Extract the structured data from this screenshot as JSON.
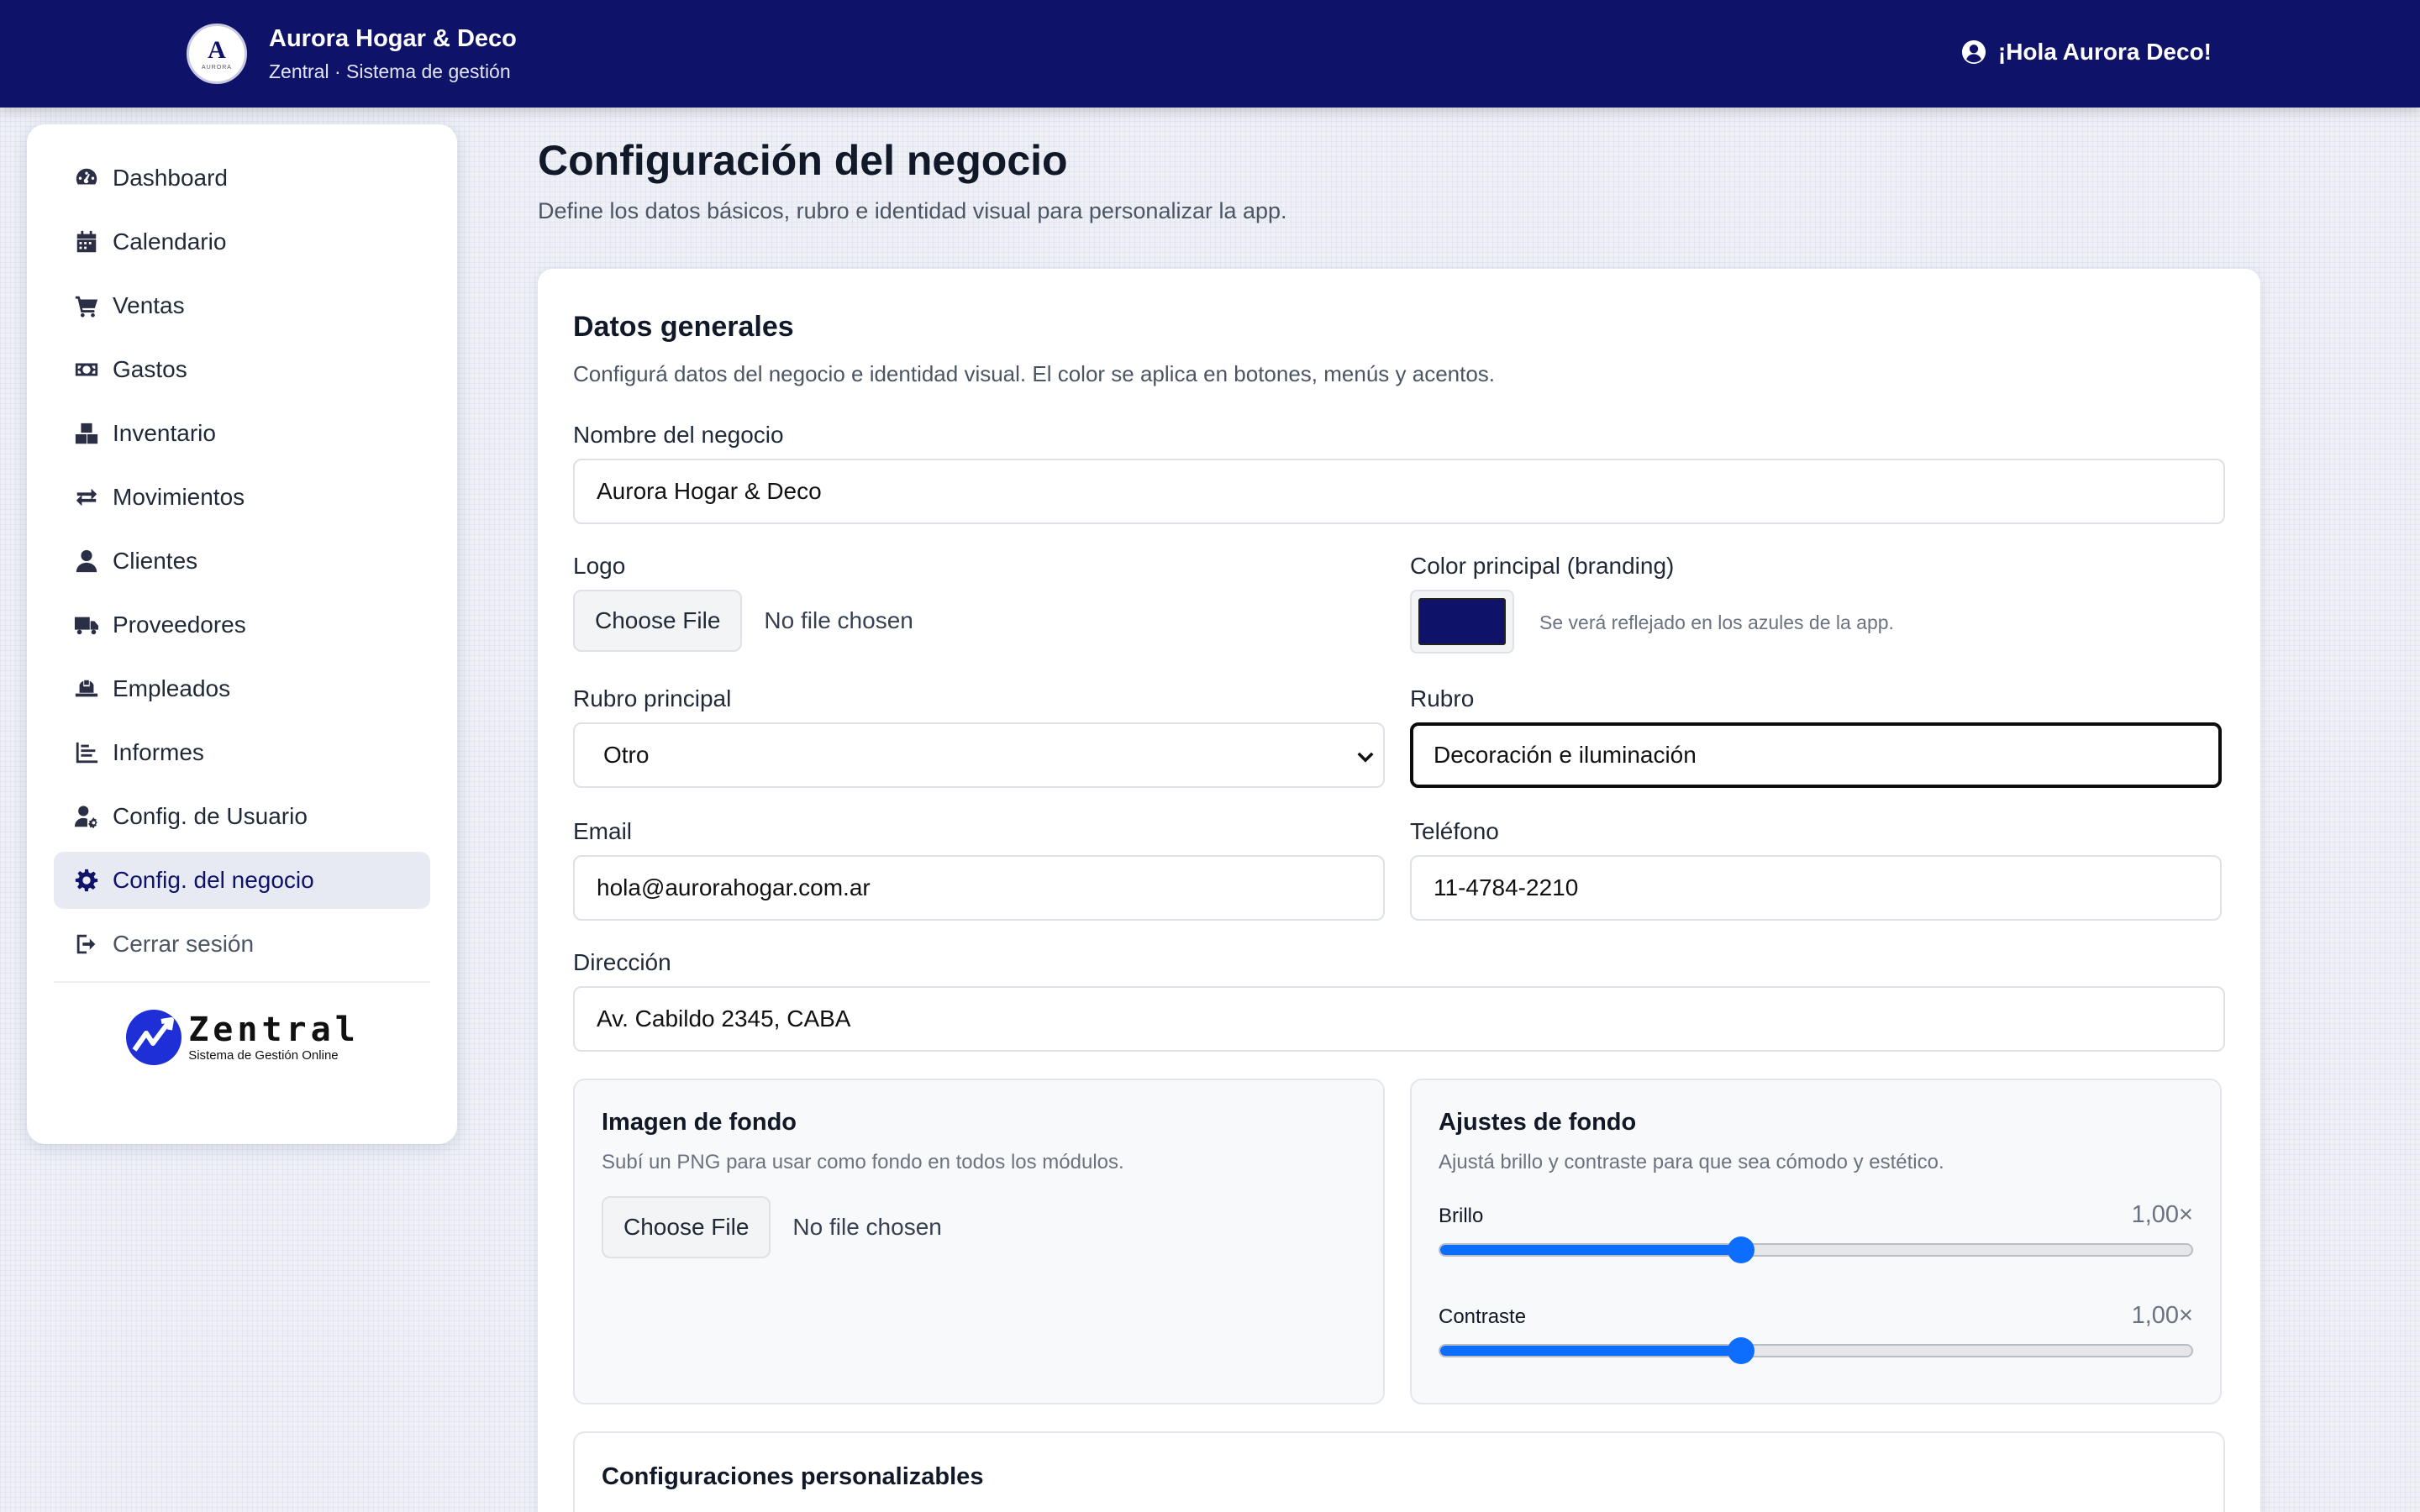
{
  "header": {
    "logo_letter": "A",
    "logo_caption": "AURORA",
    "business_name": "Aurora Hogar & Deco",
    "subtitle": "Zentral · Sistema de gestión",
    "greeting": "¡Hola Aurora Deco!",
    "background_color": "#0e1268"
  },
  "sidebar": {
    "items": [
      {
        "label": "Dashboard",
        "icon": "gauge-icon"
      },
      {
        "label": "Calendario",
        "icon": "calendar-icon"
      },
      {
        "label": "Ventas",
        "icon": "cart-icon"
      },
      {
        "label": "Gastos",
        "icon": "money-icon"
      },
      {
        "label": "Inventario",
        "icon": "boxes-icon"
      },
      {
        "label": "Movimientos",
        "icon": "arrows-icon"
      },
      {
        "label": "Clientes",
        "icon": "user-icon"
      },
      {
        "label": "Proveedores",
        "icon": "truck-icon"
      },
      {
        "label": "Empleados",
        "icon": "hardhat-icon"
      },
      {
        "label": "Informes",
        "icon": "chart-icon"
      },
      {
        "label": "Config. de Usuario",
        "icon": "user-gear-icon"
      },
      {
        "label": "Config. del negocio",
        "icon": "gear-icon",
        "active": true
      },
      {
        "label": "Cerrar sesión",
        "icon": "logout-icon"
      }
    ],
    "footer_logo": {
      "name": "Zentral",
      "tagline": "Sistema de Gestión Online"
    }
  },
  "page": {
    "title": "Configuración del negocio",
    "subtitle": "Define los datos básicos, rubro e identidad visual para personalizar la app."
  },
  "general": {
    "title": "Datos generales",
    "subtitle": "Configurá datos del negocio e identidad visual. El color se aplica en botones, menús y acentos.",
    "business_name_label": "Nombre del negocio",
    "business_name_value": "Aurora Hogar & Deco",
    "logo_label": "Logo",
    "logo_button": "Choose File",
    "logo_status": "No file chosen",
    "color_label": "Color principal (branding)",
    "color_value": "#0e1268",
    "color_hint": "Se verá reflejado en los azules de la app.",
    "main_category_label": "Rubro principal",
    "main_category_value": "Otro",
    "category_label": "Rubro",
    "category_value": "Decoración e iluminación",
    "email_label": "Email",
    "email_value": "hola@aurorahogar.com.ar",
    "phone_label": "Teléfono",
    "phone_value": "11-4784-2210",
    "address_label": "Dirección",
    "address_value": "Av. Cabildo 2345, CABA"
  },
  "background_image": {
    "title": "Imagen de fondo",
    "subtitle": "Subí un PNG para usar como fondo en todos los módulos.",
    "button": "Choose File",
    "status": "No file chosen"
  },
  "background_settings": {
    "title": "Ajustes de fondo",
    "subtitle": "Ajustá brillo y contraste para que sea cómodo y estético.",
    "brightness_label": "Brillo",
    "brightness_value": "1,00×",
    "brightness_fraction": 0.4,
    "contrast_label": "Contraste",
    "contrast_value": "1,00×",
    "contrast_fraction": 0.4,
    "accent_color": "#0d6efd"
  },
  "custom": {
    "title": "Configuraciones personalizables"
  }
}
